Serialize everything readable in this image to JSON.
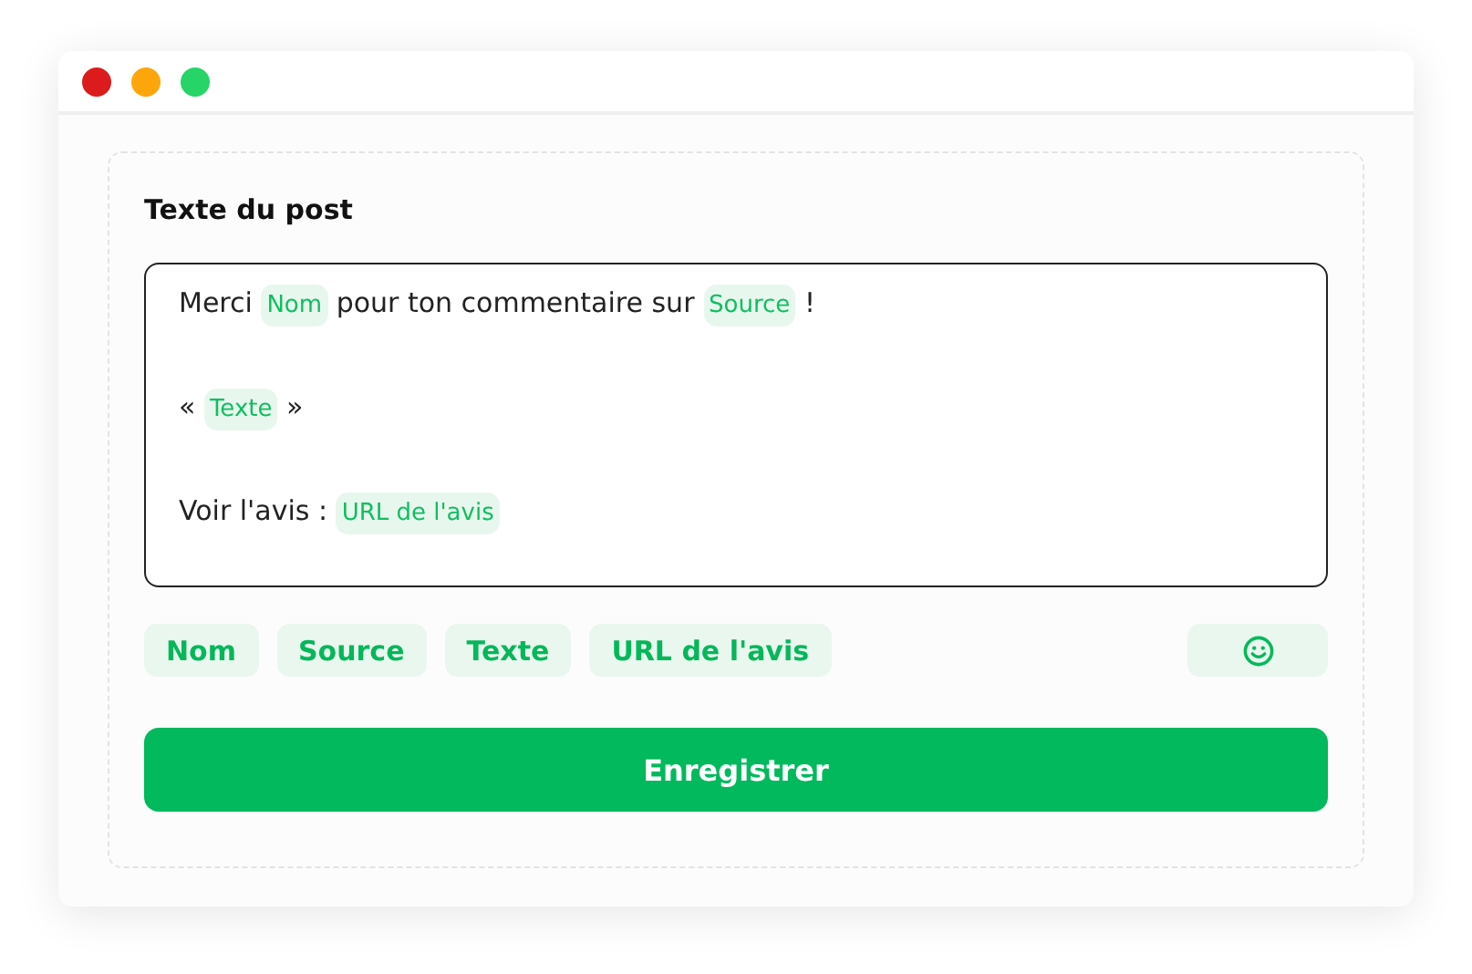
{
  "window": {
    "controls": [
      {
        "color": "#dc1c1c"
      },
      {
        "color": "#fca60c"
      },
      {
        "color": "#26d467"
      }
    ]
  },
  "title": "Texte du post",
  "editor": {
    "lines": [
      [
        {
          "kind": "text",
          "text": "Merci "
        },
        {
          "kind": "tag",
          "text": "Nom"
        },
        {
          "kind": "text",
          "text": " pour ton commentaire sur "
        },
        {
          "kind": "tag",
          "text": "Source"
        },
        {
          "kind": "text",
          "text": " !"
        }
      ],
      [
        {
          "kind": "text",
          "text": "« "
        },
        {
          "kind": "tag",
          "text": "Texte"
        },
        {
          "kind": "text",
          "text": " »"
        }
      ],
      [
        {
          "kind": "text",
          "text": "Voir l'avis : "
        },
        {
          "kind": "tag",
          "text": "URL de l'avis"
        }
      ]
    ]
  },
  "variables": [
    "Nom",
    "Source",
    "Texte",
    "URL de l'avis"
  ],
  "save_button": "Enregistrer"
}
